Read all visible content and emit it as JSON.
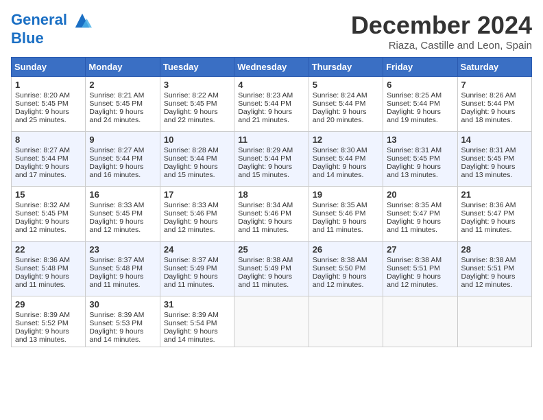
{
  "header": {
    "logo_line1": "General",
    "logo_line2": "Blue",
    "month_title": "December 2024",
    "location": "Riaza, Castille and Leon, Spain"
  },
  "days_of_week": [
    "Sunday",
    "Monday",
    "Tuesday",
    "Wednesday",
    "Thursday",
    "Friday",
    "Saturday"
  ],
  "weeks": [
    [
      {
        "day": "1",
        "lines": [
          "Sunrise: 8:20 AM",
          "Sunset: 5:45 PM",
          "Daylight: 9 hours",
          "and 25 minutes."
        ]
      },
      {
        "day": "2",
        "lines": [
          "Sunrise: 8:21 AM",
          "Sunset: 5:45 PM",
          "Daylight: 9 hours",
          "and 24 minutes."
        ]
      },
      {
        "day": "3",
        "lines": [
          "Sunrise: 8:22 AM",
          "Sunset: 5:45 PM",
          "Daylight: 9 hours",
          "and 22 minutes."
        ]
      },
      {
        "day": "4",
        "lines": [
          "Sunrise: 8:23 AM",
          "Sunset: 5:44 PM",
          "Daylight: 9 hours",
          "and 21 minutes."
        ]
      },
      {
        "day": "5",
        "lines": [
          "Sunrise: 8:24 AM",
          "Sunset: 5:44 PM",
          "Daylight: 9 hours",
          "and 20 minutes."
        ]
      },
      {
        "day": "6",
        "lines": [
          "Sunrise: 8:25 AM",
          "Sunset: 5:44 PM",
          "Daylight: 9 hours",
          "and 19 minutes."
        ]
      },
      {
        "day": "7",
        "lines": [
          "Sunrise: 8:26 AM",
          "Sunset: 5:44 PM",
          "Daylight: 9 hours",
          "and 18 minutes."
        ]
      }
    ],
    [
      {
        "day": "8",
        "lines": [
          "Sunrise: 8:27 AM",
          "Sunset: 5:44 PM",
          "Daylight: 9 hours",
          "and 17 minutes."
        ]
      },
      {
        "day": "9",
        "lines": [
          "Sunrise: 8:27 AM",
          "Sunset: 5:44 PM",
          "Daylight: 9 hours",
          "and 16 minutes."
        ]
      },
      {
        "day": "10",
        "lines": [
          "Sunrise: 8:28 AM",
          "Sunset: 5:44 PM",
          "Daylight: 9 hours",
          "and 15 minutes."
        ]
      },
      {
        "day": "11",
        "lines": [
          "Sunrise: 8:29 AM",
          "Sunset: 5:44 PM",
          "Daylight: 9 hours",
          "and 15 minutes."
        ]
      },
      {
        "day": "12",
        "lines": [
          "Sunrise: 8:30 AM",
          "Sunset: 5:44 PM",
          "Daylight: 9 hours",
          "and 14 minutes."
        ]
      },
      {
        "day": "13",
        "lines": [
          "Sunrise: 8:31 AM",
          "Sunset: 5:45 PM",
          "Daylight: 9 hours",
          "and 13 minutes."
        ]
      },
      {
        "day": "14",
        "lines": [
          "Sunrise: 8:31 AM",
          "Sunset: 5:45 PM",
          "Daylight: 9 hours",
          "and 13 minutes."
        ]
      }
    ],
    [
      {
        "day": "15",
        "lines": [
          "Sunrise: 8:32 AM",
          "Sunset: 5:45 PM",
          "Daylight: 9 hours",
          "and 12 minutes."
        ]
      },
      {
        "day": "16",
        "lines": [
          "Sunrise: 8:33 AM",
          "Sunset: 5:45 PM",
          "Daylight: 9 hours",
          "and 12 minutes."
        ]
      },
      {
        "day": "17",
        "lines": [
          "Sunrise: 8:33 AM",
          "Sunset: 5:46 PM",
          "Daylight: 9 hours",
          "and 12 minutes."
        ]
      },
      {
        "day": "18",
        "lines": [
          "Sunrise: 8:34 AM",
          "Sunset: 5:46 PM",
          "Daylight: 9 hours",
          "and 11 minutes."
        ]
      },
      {
        "day": "19",
        "lines": [
          "Sunrise: 8:35 AM",
          "Sunset: 5:46 PM",
          "Daylight: 9 hours",
          "and 11 minutes."
        ]
      },
      {
        "day": "20",
        "lines": [
          "Sunrise: 8:35 AM",
          "Sunset: 5:47 PM",
          "Daylight: 9 hours",
          "and 11 minutes."
        ]
      },
      {
        "day": "21",
        "lines": [
          "Sunrise: 8:36 AM",
          "Sunset: 5:47 PM",
          "Daylight: 9 hours",
          "and 11 minutes."
        ]
      }
    ],
    [
      {
        "day": "22",
        "lines": [
          "Sunrise: 8:36 AM",
          "Sunset: 5:48 PM",
          "Daylight: 9 hours",
          "and 11 minutes."
        ]
      },
      {
        "day": "23",
        "lines": [
          "Sunrise: 8:37 AM",
          "Sunset: 5:48 PM",
          "Daylight: 9 hours",
          "and 11 minutes."
        ]
      },
      {
        "day": "24",
        "lines": [
          "Sunrise: 8:37 AM",
          "Sunset: 5:49 PM",
          "Daylight: 9 hours",
          "and 11 minutes."
        ]
      },
      {
        "day": "25",
        "lines": [
          "Sunrise: 8:38 AM",
          "Sunset: 5:49 PM",
          "Daylight: 9 hours",
          "and 11 minutes."
        ]
      },
      {
        "day": "26",
        "lines": [
          "Sunrise: 8:38 AM",
          "Sunset: 5:50 PM",
          "Daylight: 9 hours",
          "and 12 minutes."
        ]
      },
      {
        "day": "27",
        "lines": [
          "Sunrise: 8:38 AM",
          "Sunset: 5:51 PM",
          "Daylight: 9 hours",
          "and 12 minutes."
        ]
      },
      {
        "day": "28",
        "lines": [
          "Sunrise: 8:38 AM",
          "Sunset: 5:51 PM",
          "Daylight: 9 hours",
          "and 12 minutes."
        ]
      }
    ],
    [
      {
        "day": "29",
        "lines": [
          "Sunrise: 8:39 AM",
          "Sunset: 5:52 PM",
          "Daylight: 9 hours",
          "and 13 minutes."
        ]
      },
      {
        "day": "30",
        "lines": [
          "Sunrise: 8:39 AM",
          "Sunset: 5:53 PM",
          "Daylight: 9 hours",
          "and 14 minutes."
        ]
      },
      {
        "day": "31",
        "lines": [
          "Sunrise: 8:39 AM",
          "Sunset: 5:54 PM",
          "Daylight: 9 hours",
          "and 14 minutes."
        ]
      },
      null,
      null,
      null,
      null
    ]
  ]
}
